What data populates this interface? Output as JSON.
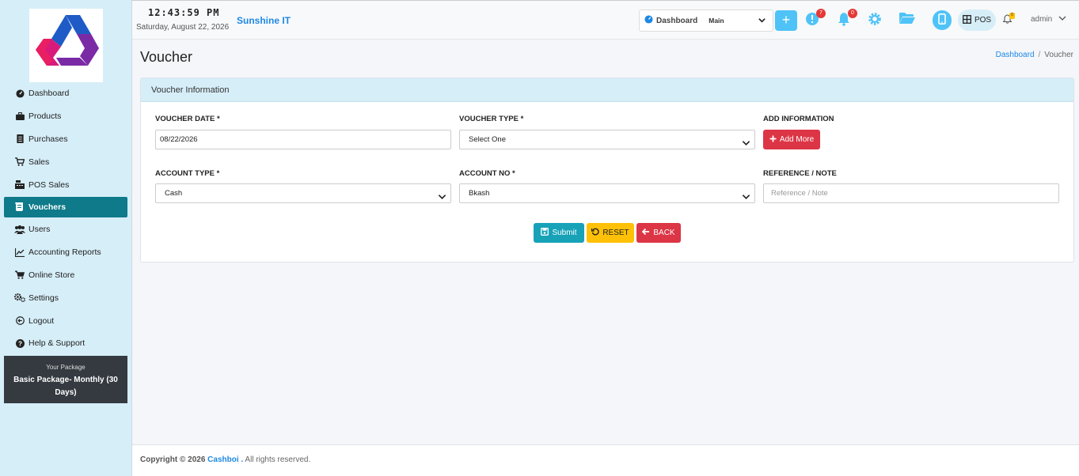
{
  "header": {
    "clock": "12:43:59 PM",
    "date": "Saturday, August 22, 2026",
    "company": "Sunshine IT",
    "dashboard_label": "Dashboard",
    "dashboard_value": "Main",
    "alerts_count": "7",
    "notifications_count": "0",
    "pos_label": "POS",
    "bell_count": "0",
    "user": "admin"
  },
  "sidebar": {
    "items": [
      {
        "label": "Dashboard",
        "icon": "gauge-icon"
      },
      {
        "label": "Products",
        "icon": "briefcase-icon"
      },
      {
        "label": "Purchases",
        "icon": "document-icon"
      },
      {
        "label": "Sales",
        "icon": "cart-icon"
      },
      {
        "label": "POS Sales",
        "icon": "cash-register-icon"
      },
      {
        "label": "Vouchers",
        "icon": "receipt-icon",
        "active": true
      },
      {
        "label": "Users",
        "icon": "users-icon"
      },
      {
        "label": "Accounting Reports",
        "icon": "line-chart-icon"
      },
      {
        "label": "Online Store",
        "icon": "store-cart-icon"
      },
      {
        "label": "Settings",
        "icon": "gears-icon"
      },
      {
        "label": "Logout",
        "icon": "logout-icon"
      },
      {
        "label": "Help & Support",
        "icon": "help-icon"
      }
    ],
    "package_label": "Your Package",
    "package_name": "Basic Package- Monthly (30 Days)"
  },
  "page": {
    "title": "Voucher",
    "breadcrumb": [
      "Dashboard",
      "Voucher"
    ]
  },
  "form": {
    "card_title": "Voucher Information",
    "voucher_date_label": "VOUCHER DATE *",
    "voucher_date_value": "08/22/2026",
    "voucher_type_label": "VOUCHER TYPE *",
    "voucher_type_value": "Select One",
    "add_info_label": "ADD INFORMATION",
    "add_more_button": "Add More",
    "account_type_label": "ACCOUNT TYPE *",
    "account_type_value": "Cash",
    "account_no_label": "ACCOUNT NO *",
    "account_no_value": "Bkash",
    "reference_label": "REFERENCE / NOTE",
    "reference_placeholder": "Reference / Note",
    "submit_button": "Submit",
    "reset_button": "RESET",
    "back_button": "BACK"
  },
  "footer": {
    "copyright": "Copyright © 2026",
    "brand": "Cashboi .",
    "rights": "All rights reserved."
  },
  "colors": {
    "sidebar_bg": "#d6eef8",
    "active_nav": "#0e7a8a",
    "accent_blue": "#4fc3f7",
    "danger": "#dc3545",
    "info": "#17a2b8",
    "warning": "#ffc107"
  }
}
